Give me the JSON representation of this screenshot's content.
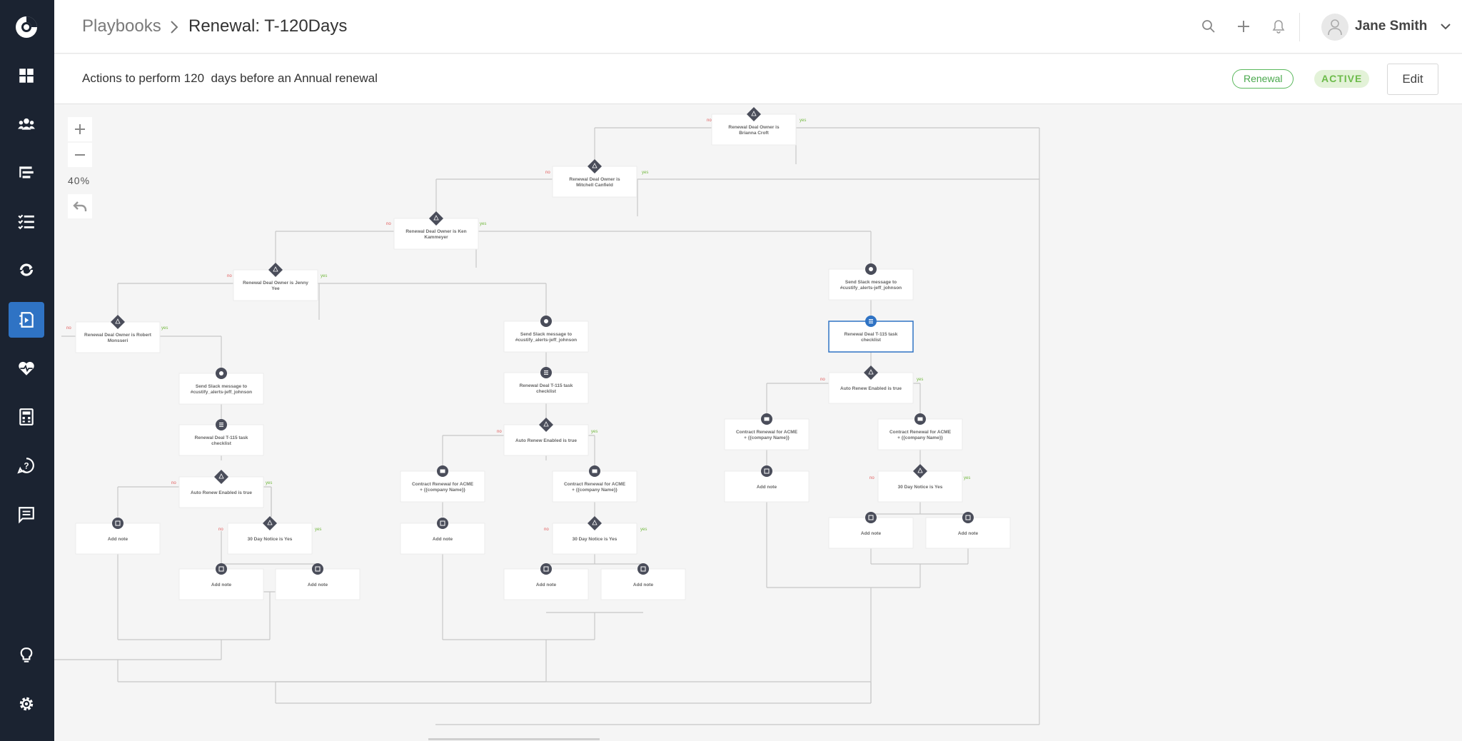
{
  "sidebar": {
    "items": [
      {
        "icon": "dashboard-icon"
      },
      {
        "icon": "users-icon"
      },
      {
        "icon": "hierarchy-icon"
      },
      {
        "icon": "checklist-icon"
      },
      {
        "icon": "sync-icon"
      },
      {
        "icon": "playbook-icon",
        "active": true
      },
      {
        "icon": "health-icon"
      },
      {
        "icon": "calculator-icon"
      },
      {
        "icon": "help-icon"
      },
      {
        "icon": "messages-icon"
      }
    ],
    "bottom": [
      {
        "icon": "lightbulb-icon"
      },
      {
        "icon": "gear-icon"
      }
    ]
  },
  "header": {
    "breadcrumb_root": "Playbooks",
    "breadcrumb_current": "Renewal: T-120Days",
    "user_name": "Jane Smith"
  },
  "subheader": {
    "description": "Actions to perform 120  days before an Annual renewal",
    "tag": "Renewal",
    "status": "ACTIVE",
    "edit_label": "Edit"
  },
  "canvas": {
    "zoom_level": "40%"
  },
  "colors": {
    "sidebar_bg": "#1b2331",
    "accent": "#2f73c4",
    "tag_green": "#5ab85c",
    "branch_no": "#e05a5a",
    "branch_yes": "#72b83e",
    "node_icon": "#4a4d5a"
  },
  "flow": {
    "branch_no": "no",
    "branch_yes": "yes",
    "nodes": [
      {
        "text": [
          "Renewal Deal Owner is",
          "Brianna Croft"
        ],
        "kind": "condition"
      },
      {
        "text": [
          "Renewal Deal Owner is",
          "Mitchell Canfield"
        ],
        "kind": "condition"
      },
      {
        "text": [
          "Renewal Deal Owner is Ken",
          "Kammeyer"
        ],
        "kind": "condition"
      },
      {
        "text": [
          "Renewal Deal Owner is Jenny",
          "Yee"
        ],
        "kind": "condition"
      },
      {
        "text": [
          "Renewal Deal Owner is Robert",
          "Monsseri"
        ],
        "kind": "condition"
      },
      {
        "text": [
          "Send Slack message to",
          "#custify_alerts-jeff_johnson"
        ],
        "kind": "slack"
      },
      {
        "text": [
          "Renewal Deal T-115 task",
          "checklist"
        ],
        "kind": "task"
      },
      {
        "text": [
          "Auto Renew Enabled is true"
        ],
        "kind": "condition"
      },
      {
        "text": [
          "Add note"
        ],
        "kind": "note"
      },
      {
        "text": [
          "30 Day Notice is Yes"
        ],
        "kind": "condition"
      },
      {
        "text": [
          "Contract Renewal for ACME",
          "+ {{company Name}}"
        ],
        "kind": "email"
      }
    ]
  }
}
